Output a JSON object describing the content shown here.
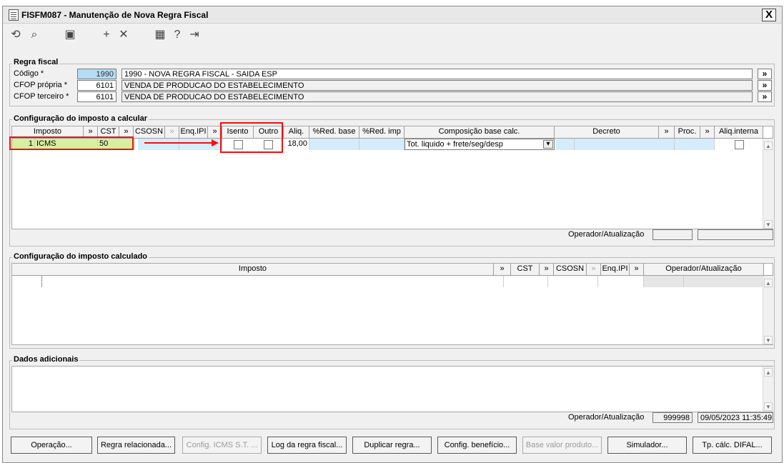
{
  "window": {
    "title": "FISFM087 - Manutenção de Nova Regra Fiscal",
    "close_label": "X"
  },
  "toolbar": {
    "icons": [
      "undo-icon",
      "search-icon",
      "save-icon",
      "add-icon",
      "delete-icon",
      "calendar-icon",
      "help-icon",
      "exit-icon"
    ],
    "glyphs": [
      "⟲",
      "⌕",
      "▣",
      "+",
      "✕",
      "▦",
      "?",
      "⇥"
    ]
  },
  "regra_fiscal": {
    "title": "Regra fiscal",
    "codigo_label": "Código *",
    "codigo_value": "1990",
    "codigo_desc": "1990 - NOVA REGRA FISCAL - SAIDA ESP",
    "cfop_propria_label": "CFOP própria *",
    "cfop_propria_value": "6101",
    "cfop_propria_desc": "VENDA DE PRODUCAO DO ESTABELECIMENTO",
    "cfop_terceiro_label": "CFOP terceiro *",
    "cfop_terceiro_value": "6101",
    "cfop_terceiro_desc": "VENDA DE PRODUCAO DO ESTABELECIMENTO",
    "lookup_glyph": "»"
  },
  "imposto_calcular": {
    "title": "Configuração do imposto a calcular",
    "headers": {
      "imposto": "Imposto",
      "cst": "CST",
      "csosn": "CSOSN",
      "enq_ipi": "Enq.IPI",
      "isento": "Isento",
      "outro": "Outro",
      "aliq": "Aliq.",
      "red_base": "%Red. base",
      "red_imp": "%Red. imp",
      "composicao": "Composição base calc.",
      "decreto": "Decreto",
      "proc": "Proc.",
      "aliq_interna": "Aliq.interna",
      "lookup": "»",
      "lookup_disabled": "»"
    },
    "row": {
      "num": "1",
      "imposto": "ICMS",
      "cst": "50",
      "aliq": "18,00",
      "composicao": "Tot. liquido + frete/seg/desp",
      "dropdown": "▾"
    },
    "operador_label": "Operador/Atualização",
    "operador_value": "",
    "atualizacao_value": ""
  },
  "imposto_calculado": {
    "title": "Configuração do imposto calculado",
    "headers": {
      "imposto": "Imposto",
      "cst": "CST",
      "csosn": "CSOSN",
      "enq_ipi": "Enq.IPI",
      "operador": "Operador/Atualização",
      "lookup": "»"
    }
  },
  "dados_adicionais": {
    "title": "Dados adicionais",
    "operador_label": "Operador/Atualização",
    "operador_value": "999998",
    "atualizacao_value": "09/05/2023 11:35:49"
  },
  "buttons": {
    "operacao": "Operação...",
    "regra_relacionada": "Regra relacionada...",
    "config_icms_st": "Config. ICMS S.T. ...",
    "log_regra": "Log da regra fiscal...",
    "duplicar_regra": "Duplicar regra...",
    "config_beneficio": "Config. benefício...",
    "base_valor_produto": "Base valor produto...",
    "simulador": "Simulador...",
    "tp_calc_difal": "Tp. cálc. DIFAL..."
  },
  "scroll": {
    "up": "▲",
    "down": "▼"
  },
  "colors": {
    "highlight_red": "#e11111",
    "row_green": "#d7ef9f",
    "cell_blue": "#d4ecfb",
    "selection_blue": "#b4dcf6"
  }
}
